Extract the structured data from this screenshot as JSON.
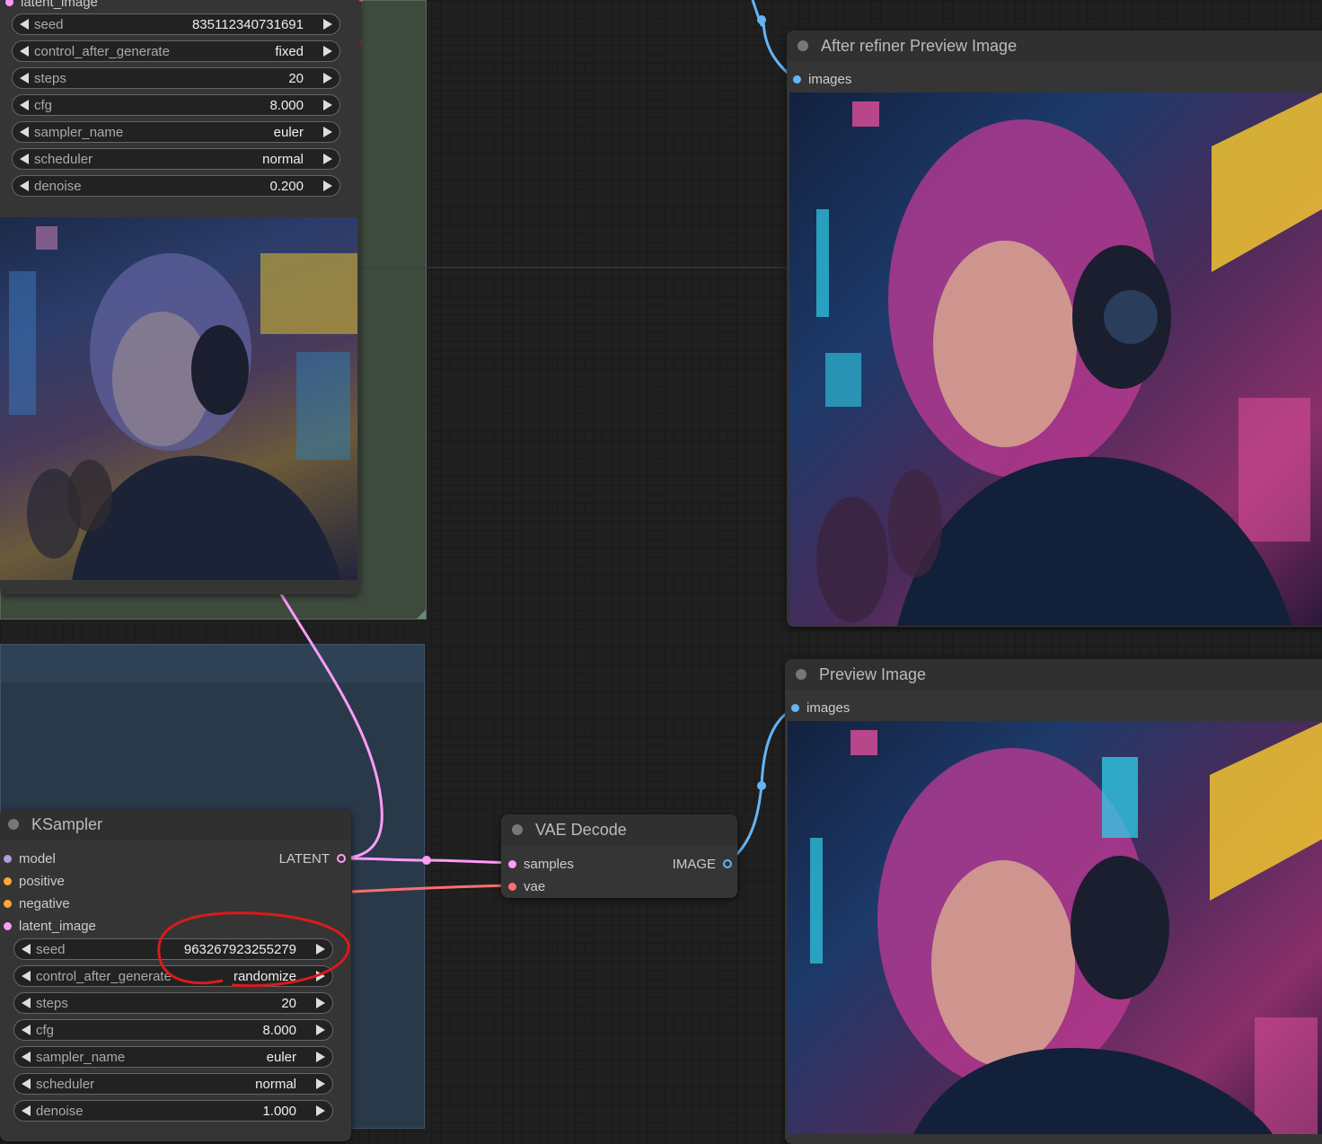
{
  "top_sampler": {
    "cut_label": "latent_image",
    "widgets": [
      {
        "name": "seed",
        "value": "835112340731691"
      },
      {
        "name": "control_after_generate",
        "value": "fixed"
      },
      {
        "name": "steps",
        "value": "20"
      },
      {
        "name": "cfg",
        "value": "8.000"
      },
      {
        "name": "sampler_name",
        "value": "euler"
      },
      {
        "name": "scheduler",
        "value": "normal"
      },
      {
        "name": "denoise",
        "value": "0.200"
      }
    ]
  },
  "after_refiner_preview": {
    "title": "After refiner Preview Image",
    "input_label": "images"
  },
  "preview_image": {
    "title": "Preview Image",
    "input_label": "images"
  },
  "vae_decode": {
    "title": "VAE Decode",
    "inputs": [
      "samples",
      "vae"
    ],
    "output": "IMAGE"
  },
  "ksampler": {
    "title": "KSampler",
    "inputs": [
      "model",
      "positive",
      "negative",
      "latent_image"
    ],
    "output": "LATENT",
    "widgets": [
      {
        "name": "seed",
        "value": "963267923255279"
      },
      {
        "name": "control_after_generate",
        "value": "randomize"
      },
      {
        "name": "steps",
        "value": "20"
      },
      {
        "name": "cfg",
        "value": "8.000"
      },
      {
        "name": "sampler_name",
        "value": "euler"
      },
      {
        "name": "scheduler",
        "value": "normal"
      },
      {
        "name": "denoise",
        "value": "1.000"
      }
    ]
  },
  "colors": {
    "latent": "#ff9cf9",
    "image": "#64b5f6",
    "vae": "#ff6e6e",
    "model": "#b39ddb",
    "conditioning": "#ffa931",
    "annotation": "#d81b1b"
  },
  "icons": [
    "arrow-left-icon",
    "arrow-right-icon",
    "slot-dot-icon",
    "node-collapse-dot-icon"
  ]
}
